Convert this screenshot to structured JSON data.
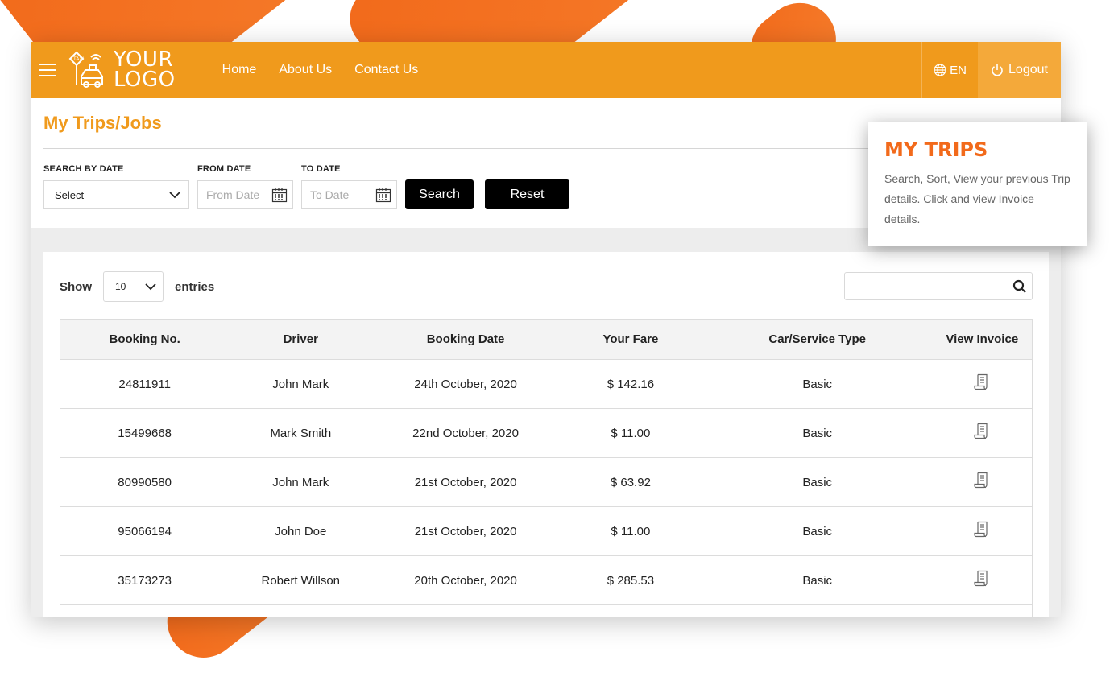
{
  "header": {
    "logo_line1": "YOUR",
    "logo_line2": "LOGO",
    "nav": [
      "Home",
      "About Us",
      "Contact Us"
    ],
    "language": "EN",
    "logout": "Logout"
  },
  "page": {
    "title": "My Trips/Jobs"
  },
  "filters": {
    "search_by_date_label": "SEARCH BY DATE",
    "search_by_date_value": "Select",
    "from_date_label": "FROM DATE",
    "from_date_placeholder": "From Date",
    "to_date_label": "TO DATE",
    "to_date_placeholder": "To Date",
    "search_button": "Search",
    "reset_button": "Reset"
  },
  "table_controls": {
    "show_label": "Show",
    "entries_value": "10",
    "entries_label": "entries"
  },
  "table": {
    "columns": [
      "Booking No.",
      "Driver",
      "Booking Date",
      "Your Fare",
      "Car/Service Type",
      "View Invoice"
    ],
    "rows": [
      {
        "booking_no": "24811911",
        "driver": "John Mark",
        "date": "24th October, 2020",
        "fare": "$ 142.16",
        "type": "Basic"
      },
      {
        "booking_no": "15499668",
        "driver": "Mark Smith",
        "date": "22nd October, 2020",
        "fare": "$ 11.00",
        "type": "Basic"
      },
      {
        "booking_no": "80990580",
        "driver": "John Mark",
        "date": "21st October, 2020",
        "fare": "$ 63.92",
        "type": "Basic"
      },
      {
        "booking_no": "95066194",
        "driver": "John Doe",
        "date": "21st October, 2020",
        "fare": "$ 11.00",
        "type": "Basic"
      },
      {
        "booking_no": "35173273",
        "driver": "Robert Willson",
        "date": "20th October, 2020",
        "fare": "$ 285.53",
        "type": "Basic"
      }
    ]
  },
  "tooltip": {
    "title": "MY TRIPS",
    "text": "Search, Sort, View your previous Trip details. Click and view Invoice details."
  },
  "colors": {
    "brand_orange": "#f09a1c",
    "accent_orange": "#f26a1b"
  },
  "icons": {
    "menu": "hamburger-icon",
    "logo": "taxi-icon",
    "language": "globe-icon",
    "logout": "power-icon",
    "calendar": "calendar-icon",
    "search": "search-icon",
    "invoice": "invoice-icon"
  }
}
